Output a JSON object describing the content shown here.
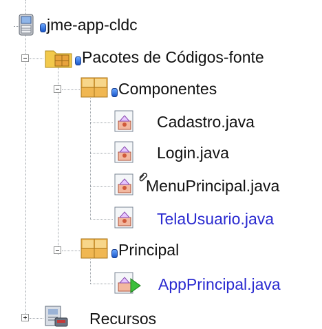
{
  "tree": {
    "project": {
      "label": "jme-app-cldc",
      "icon": "mobile-project-icon"
    },
    "sources": {
      "label": "Pacotes de Códigos-fonte",
      "icon": "folder-sources-icon",
      "expanded": true
    },
    "packages": [
      {
        "label": "Componentes",
        "icon": "package-icon",
        "expanded": true,
        "files": [
          {
            "label": "Cadastro.java",
            "color": "#111111",
            "icon": "java-class-icon"
          },
          {
            "label": "Login.java",
            "color": "#111111",
            "icon": "java-class-icon"
          },
          {
            "label": "MenuPrincipal.java",
            "color": "#111111",
            "icon": "java-class-icon",
            "badge": "link-badge-icon"
          },
          {
            "label": "TelaUsuario.java",
            "color": "#2a2ad0",
            "icon": "java-class-icon"
          }
        ]
      },
      {
        "label": "Principal",
        "icon": "package-icon",
        "expanded": true,
        "files": [
          {
            "label": "AppPrincipal.java",
            "color": "#2a2ad0",
            "icon": "java-main-class-icon"
          }
        ]
      }
    ],
    "resources": {
      "label": "Recursos",
      "icon": "resources-icon",
      "expanded": false
    }
  }
}
